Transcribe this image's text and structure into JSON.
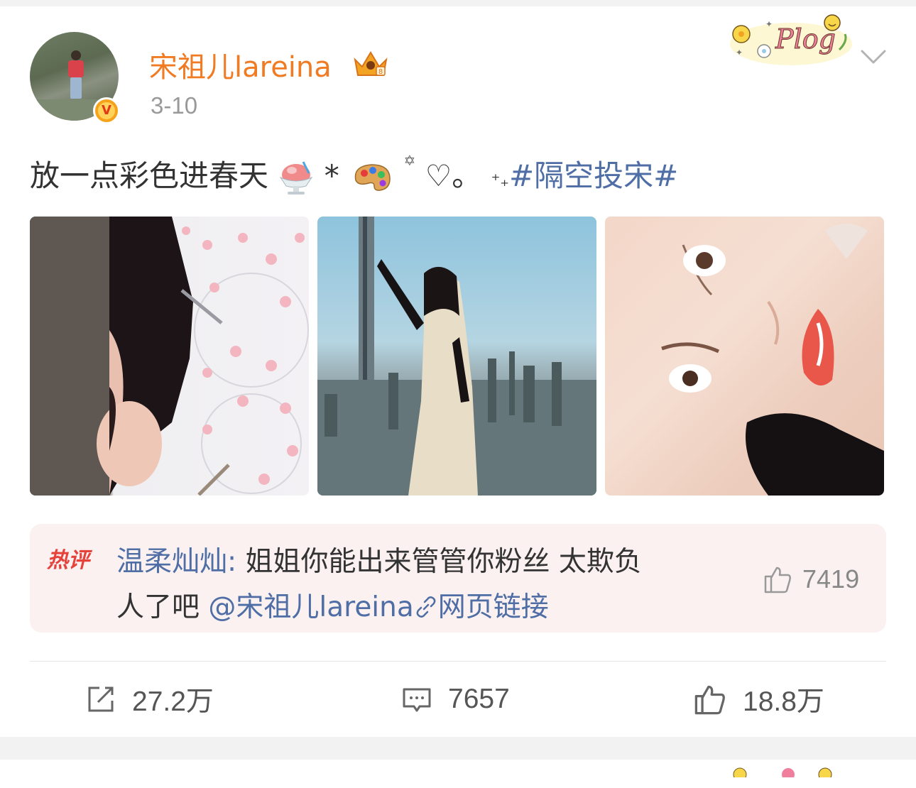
{
  "post": {
    "username": "宋祖儿lareina",
    "date": "3-10",
    "text_main": "放一点彩色进春天",
    "text_sym1": "*",
    "text_sym2": "♡。",
    "text_sym3": "⁺₊",
    "hashtag": "#隔空投宋#",
    "sticker": "Plog",
    "images": [
      "photo-1",
      "photo-2",
      "photo-3"
    ]
  },
  "hot_comment": {
    "badge": "热评",
    "author": "温柔灿灿:",
    "text_line1": " 姐姐你能出来管管你粉丝 太欺负",
    "text_line2": "人了吧 ",
    "mention": "@宋祖儿lareina",
    "link": "网页链接",
    "likes": "7419"
  },
  "actions": {
    "repost": "27.2万",
    "comment": "7657",
    "like": "18.8万"
  },
  "colors": {
    "username": "#f07b22",
    "link_blue": "#4e6ea5",
    "hot_bg": "#fbf1f1"
  },
  "icons": {
    "repost": "share-icon",
    "comment": "comment-icon",
    "like": "thumbs-up-icon",
    "menu": "chevron-down-icon",
    "link": "link-icon"
  }
}
